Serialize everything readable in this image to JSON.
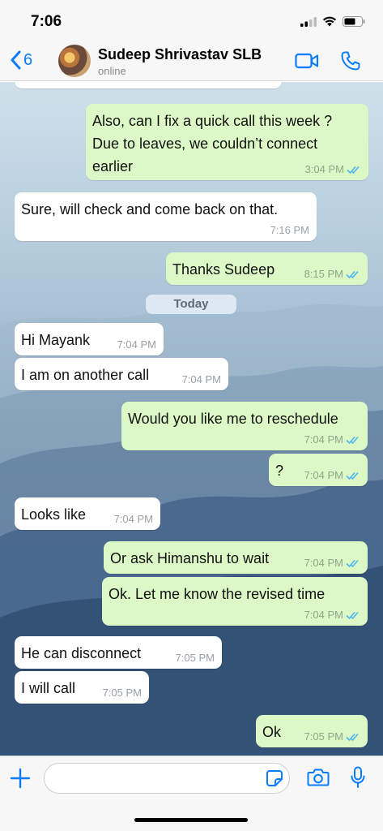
{
  "status_bar": {
    "time": "7:06"
  },
  "header": {
    "back_count": "6",
    "contact_name": "Sudeep Shrivastav SLB",
    "contact_status": "online"
  },
  "messages": [
    {
      "dir": "out",
      "text": "Also, can I fix a quick call this week ? Due to leaves, we couldn’t connect earlier",
      "time": "3:04 PM",
      "read": true
    },
    {
      "dir": "in",
      "text": "Sure, will check and come back on that.",
      "time": "7:16 PM"
    },
    {
      "dir": "out",
      "text": "Thanks Sudeep",
      "time": "8:15 PM",
      "read": true
    },
    {
      "dir": "in",
      "text": "Hi Mayank",
      "time": "7:04 PM"
    },
    {
      "dir": "in",
      "text": "I am on another call",
      "time": "7:04 PM"
    },
    {
      "dir": "out",
      "text": "Would you like me to reschedule",
      "time": "7:04 PM",
      "read": true
    },
    {
      "dir": "out",
      "text": "?",
      "time": "7:04 PM",
      "read": true
    },
    {
      "dir": "in",
      "text": "Looks like",
      "time": "7:04 PM"
    },
    {
      "dir": "out",
      "text": "Or ask Himanshu to wait",
      "time": "7:04 PM",
      "read": true
    },
    {
      "dir": "out",
      "text": "Ok. Let me know the revised time",
      "time": "7:04 PM",
      "read": true
    },
    {
      "dir": "in",
      "text": "He can disconnect",
      "time": "7:05 PM"
    },
    {
      "dir": "in",
      "text": "I will call",
      "time": "7:05 PM"
    },
    {
      "dir": "out",
      "text": "Ok",
      "time": "7:05 PM",
      "read": true
    }
  ],
  "day_separator": "Today",
  "input": {
    "placeholder": ""
  },
  "colors": {
    "accent": "#0a7cff",
    "outgoing_bubble": "#dcf8c6",
    "incoming_bubble": "#ffffff",
    "read_ticks": "#4fb6ec"
  },
  "icons": [
    "back-chevron-icon",
    "video-call-icon",
    "phone-icon",
    "plus-icon",
    "sticker-icon",
    "camera-icon",
    "mic-icon",
    "signal-icon",
    "wifi-icon",
    "battery-icon"
  ]
}
